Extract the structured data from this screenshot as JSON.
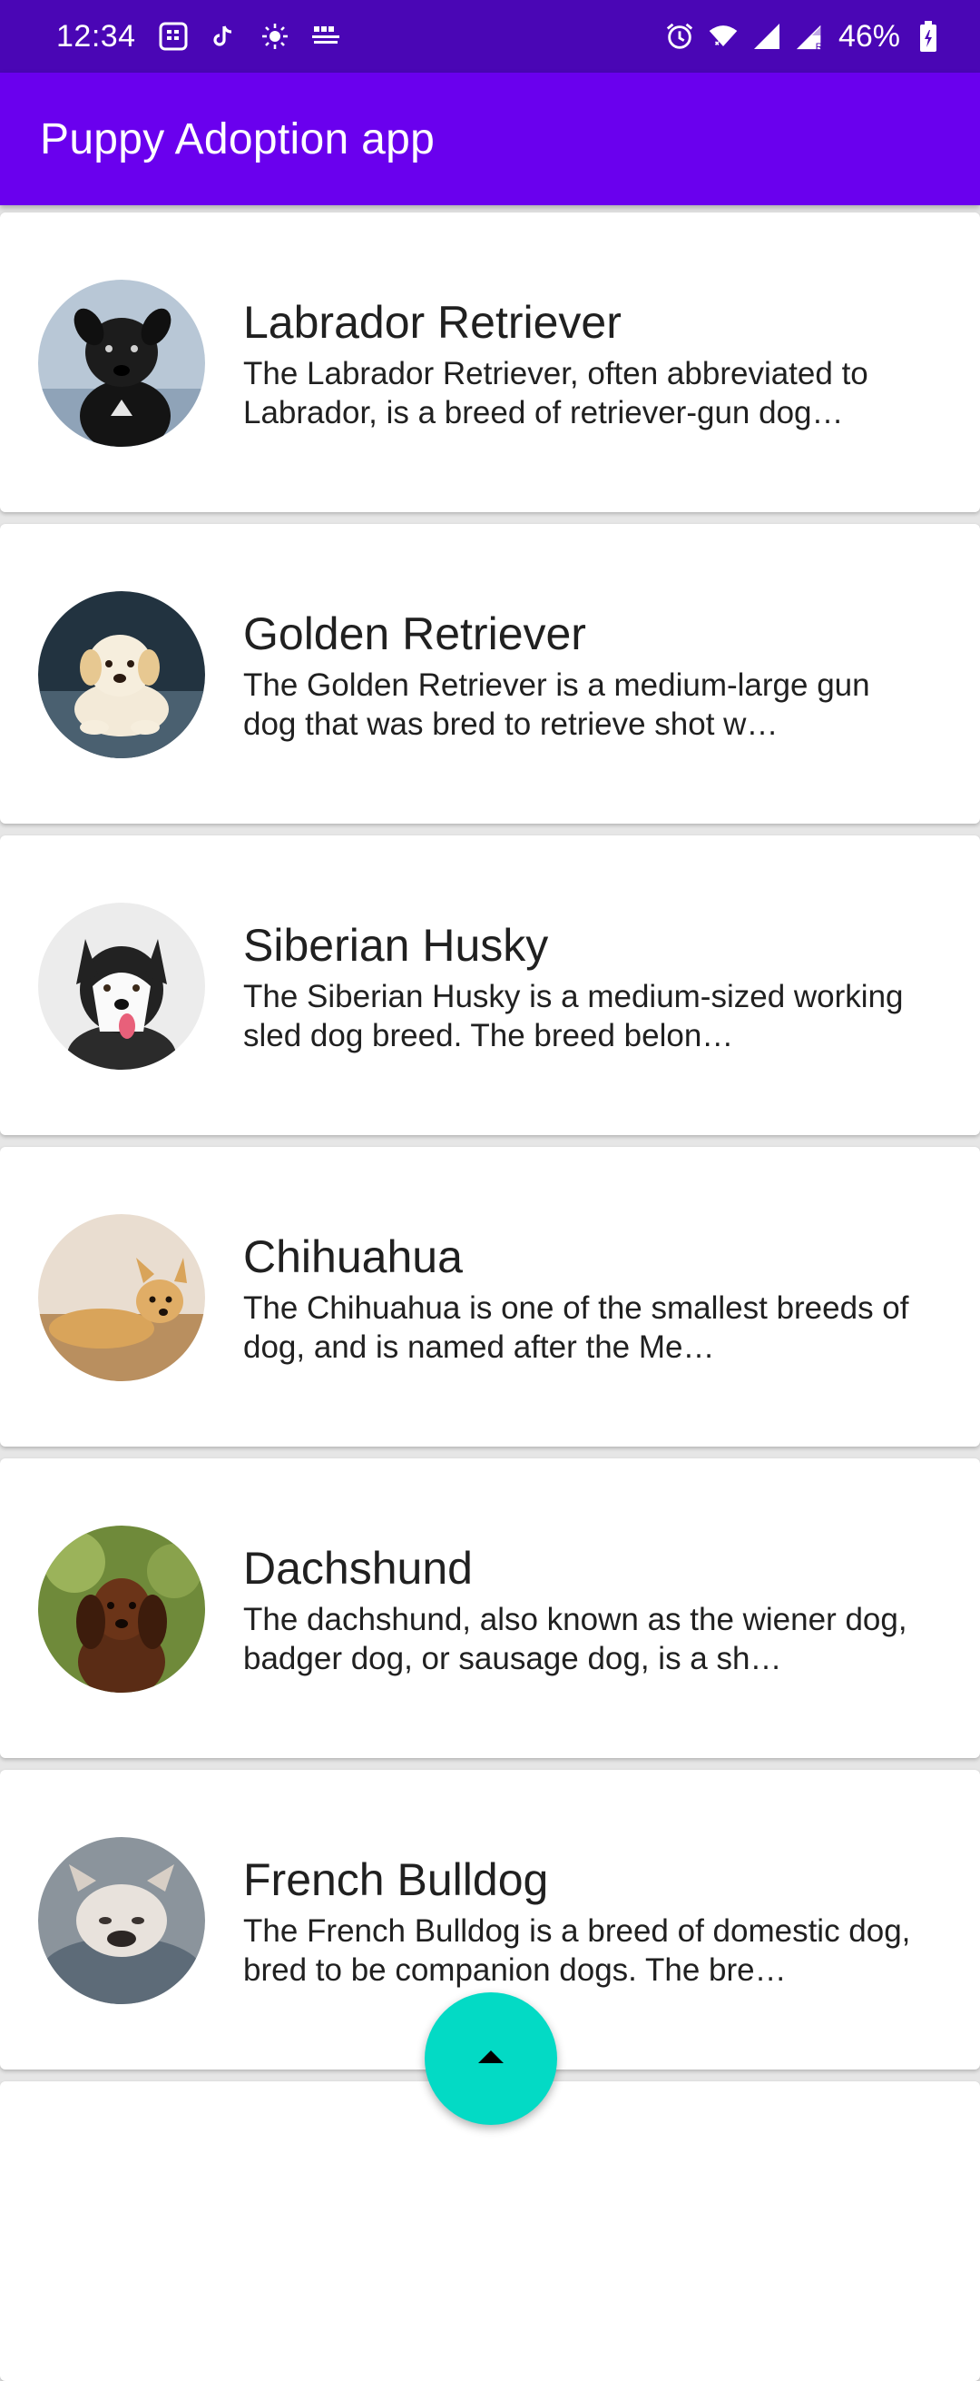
{
  "status_bar": {
    "time": "12:34",
    "battery": "46%",
    "icons": [
      "sim-icon",
      "tiktok-icon",
      "weather-icon",
      "bbc-learning-english-icon",
      "alarm-icon",
      "wifi-icon",
      "signal-icon",
      "signal-roaming-icon",
      "battery-icon"
    ]
  },
  "app_bar": {
    "title": "Puppy Adoption app"
  },
  "puppies": [
    {
      "name": "Labrador Retriever",
      "description": "The Labrador Retriever, often abbreviated to Labrador, is a breed of retriever-gun dog…"
    },
    {
      "name": "Golden Retriever",
      "description": "The Golden Retriever is a medium-large gun dog that was bred to retrieve shot w…"
    },
    {
      "name": "Siberian Husky",
      "description": "The Siberian Husky is a medium-sized working sled dog breed. The breed belon…"
    },
    {
      "name": "Chihuahua",
      "description": "The Chihuahua is one of the smallest breeds of dog, and is named after the Me…"
    },
    {
      "name": "Dachshund",
      "description": "The dachshund, also known as the wiener dog, badger dog, or sausage dog, is a sh…"
    },
    {
      "name": "French Bulldog",
      "description": "The French Bulldog is a breed of domestic dog, bred to be companion dogs. The bre…"
    }
  ],
  "fab": {
    "icon": "arrow-up-icon"
  },
  "colors": {
    "status_bar": "#4a06b5",
    "app_bar": "#6a00ee",
    "fab": "#03dac5"
  }
}
